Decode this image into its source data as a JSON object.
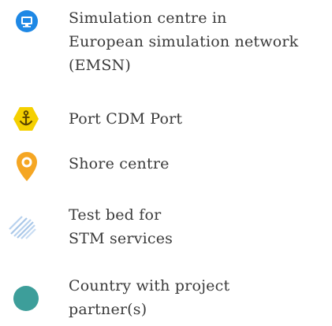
{
  "legend": {
    "items": [
      {
        "icon": "simulation-centre-icon",
        "color": "#1e88e5",
        "lines": [
          "Simulation centre in",
          "European simulation network",
          "(EMSN)"
        ]
      },
      {
        "icon": "anchor-port-icon",
        "color": "#f5d000",
        "lines": [
          "Port CDM Port"
        ]
      },
      {
        "icon": "map-pin-icon",
        "color": "#f5a623",
        "lines": [
          "Shore centre"
        ]
      },
      {
        "icon": "hatched-test-bed-icon",
        "color": "#a9c7e8",
        "lines": [
          "Test bed for",
          "STM services"
        ]
      },
      {
        "icon": "country-circle-icon",
        "color": "#3d9e9a",
        "lines": [
          "Country with project",
          "partner(s)"
        ]
      }
    ]
  }
}
